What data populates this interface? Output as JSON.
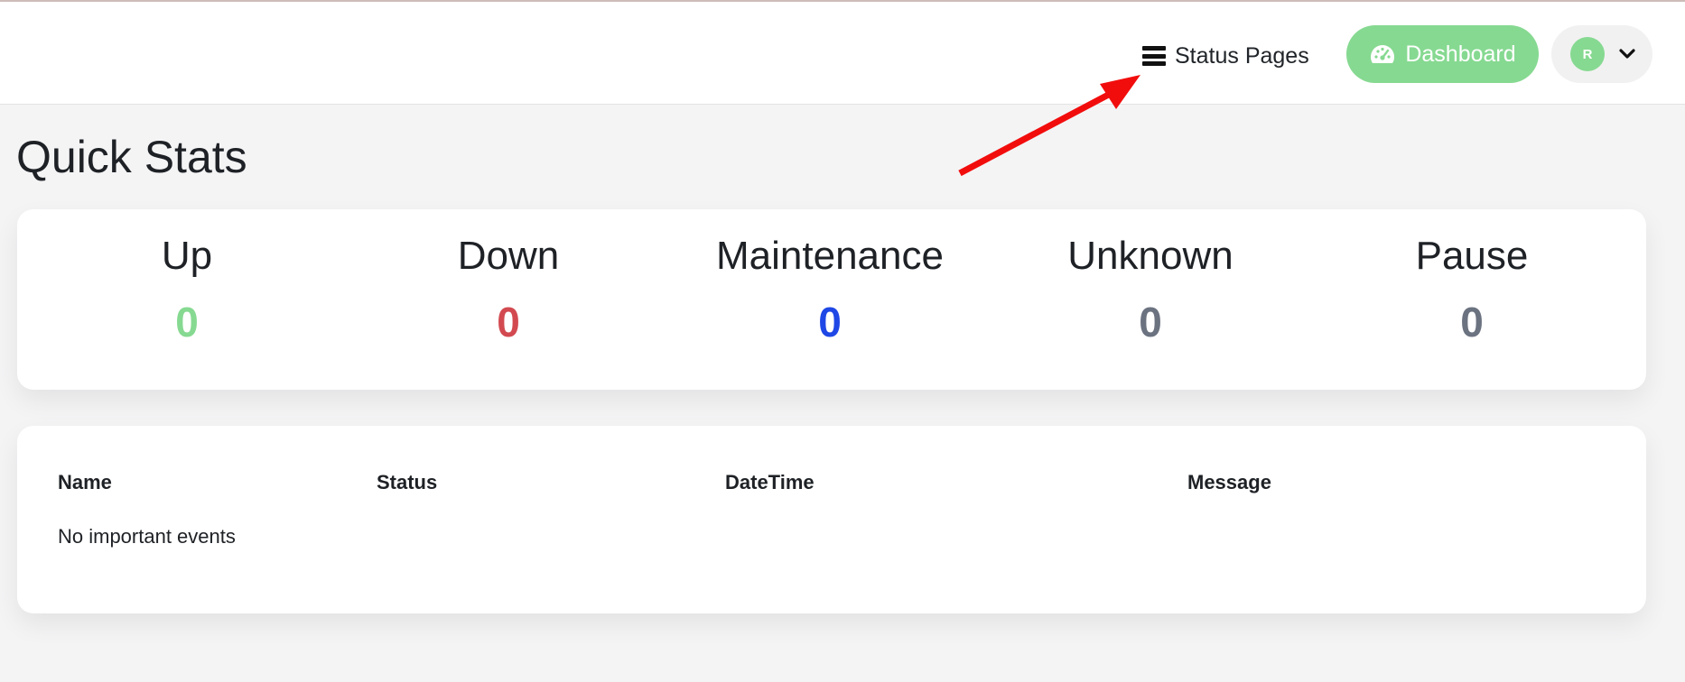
{
  "header": {
    "status_pages_label": "Status Pages",
    "dashboard_label": "Dashboard",
    "avatar_initial": "R"
  },
  "page_title": "Quick Stats",
  "stats": [
    {
      "label": "Up",
      "value": "0",
      "color": "#86d991"
    },
    {
      "label": "Down",
      "value": "0",
      "color": "#d24a50"
    },
    {
      "label": "Maintenance",
      "value": "0",
      "color": "#1f47e6"
    },
    {
      "label": "Unknown",
      "value": "0",
      "color": "#6b7280"
    },
    {
      "label": "Pause",
      "value": "0",
      "color": "#6b7280"
    }
  ],
  "events": {
    "columns": [
      "Name",
      "Status",
      "DateTime",
      "Message"
    ],
    "empty_message": "No important events"
  },
  "colors": {
    "accent": "#86d991",
    "annotation_arrow": "#f20d0d"
  },
  "icons": {
    "status_pages": "bars-icon",
    "dashboard": "tachometer-icon",
    "user_menu": "chevron-down-icon"
  }
}
